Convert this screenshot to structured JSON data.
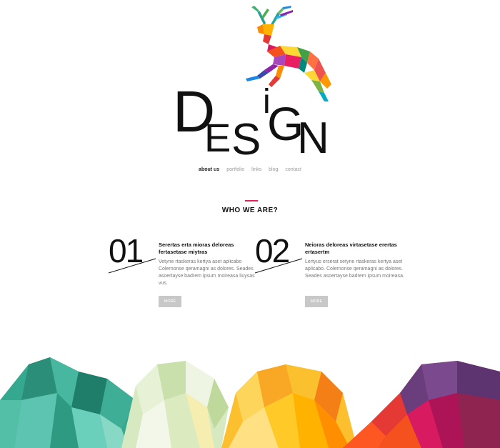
{
  "logo": {
    "letters": [
      "D",
      "E",
      "S",
      "i",
      "G",
      "N"
    ]
  },
  "nav": {
    "items": [
      {
        "label": "about us"
      },
      {
        "label": "portfolio"
      },
      {
        "label": "links"
      },
      {
        "label": "blog"
      },
      {
        "label": "contact"
      }
    ]
  },
  "section": {
    "title": "WHO WE ARE?"
  },
  "features": [
    {
      "number": "01",
      "heading": "Serertas erta mioras deloreas fertasetase miytras",
      "body": "Vetyne rtaskeras kertya aset aplicabo Colernonse qeramagni as dolores. Seades asoertayse badrem ipsum moireasa liuysas vus.",
      "more": "MORE"
    },
    {
      "number": "02",
      "heading": "Neioras deloreas virtasetase erertas ertasertm",
      "body": "Lertyus erserat setyne rtaskeras kertya aset aplicabo. Colernonse qeramagni as dolores. Seades asoertayse badrem ipsum moireasa.",
      "more": "MORE"
    }
  ],
  "colors": {
    "accent": "#e6205a",
    "more_button": "#c8c8c8"
  }
}
